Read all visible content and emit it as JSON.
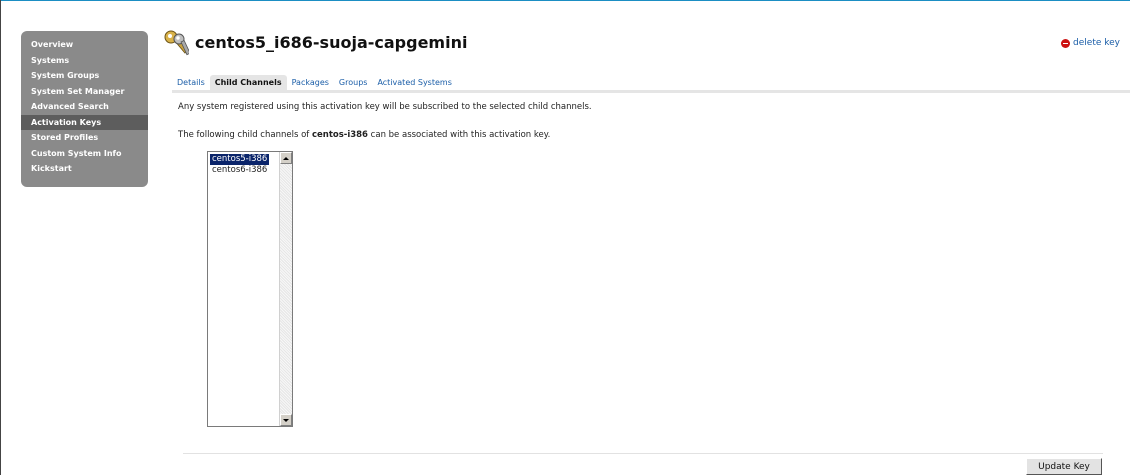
{
  "sidebar": {
    "items": [
      {
        "label": "Overview"
      },
      {
        "label": "Systems"
      },
      {
        "label": "System Groups"
      },
      {
        "label": "System Set Manager"
      },
      {
        "label": "Advanced Search"
      },
      {
        "label": "Activation Keys",
        "active": true
      },
      {
        "label": "Stored Profiles"
      },
      {
        "label": "Custom System Info"
      },
      {
        "label": "Kickstart"
      }
    ]
  },
  "header": {
    "title": "centos5_i686-suoja-capgemini",
    "icon": "key-icon",
    "delete_label": "delete key",
    "delete_icon": "delete-icon"
  },
  "tabs": [
    {
      "label": "Details"
    },
    {
      "label": "Child Channels",
      "active": true
    },
    {
      "label": "Packages"
    },
    {
      "label": "Groups"
    },
    {
      "label": "Activated Systems"
    }
  ],
  "content": {
    "description": "Any system registered using this activation key will be subscribed to the selected child channels.",
    "associate_prefix": "The following child channels of ",
    "base_channel": "centos-i386",
    "associate_suffix": " can be associated with this activation key.",
    "channels": [
      {
        "label": "centos5-i386",
        "selected": true
      },
      {
        "label": "centos6-i386",
        "selected": false
      }
    ],
    "update_button": "Update Key"
  },
  "colors": {
    "accent_link": "#1b5ea8",
    "sidebar_bg": "#8a8a8a",
    "sidebar_active": "#5d5d5d",
    "selection": "#0a246a",
    "delete": "#cc1111"
  }
}
